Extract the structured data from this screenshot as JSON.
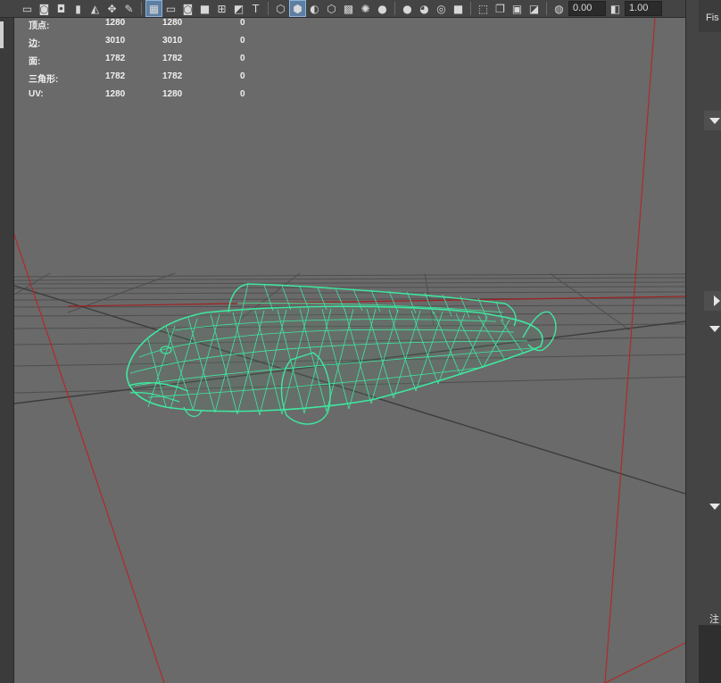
{
  "toolbar": {
    "camera_value": "0.00",
    "gamma_value": "1.00",
    "icons": [
      "camera-icon",
      "camera-attributes-icon",
      "bookmark-icon",
      "image-plane-icon",
      "2d-pan-icon",
      "grease-pencil-icon",
      "grid-icon",
      "film-gate-icon",
      "resolution-gate-icon",
      "gate-mask-icon",
      "field-chart-icon",
      "safe-action-icon",
      "safe-title-icon",
      "wireframe-icon",
      "smooth-shade-icon",
      "default-material-icon",
      "textured-icon",
      "use-all-lights-icon",
      "shadows-icon",
      "ambient-occlusion-icon",
      "motion-blur-icon",
      "anti-aliasing-icon",
      "depth-of-field-icon",
      "isolate-select-icon",
      "xray-icon",
      "xray-joints-icon",
      "backface-culling-icon",
      "exposure-icon",
      "gamma-icon"
    ]
  },
  "hud": {
    "rows": [
      {
        "label": "顶点:",
        "a": "1280",
        "b": "1280",
        "c": "0"
      },
      {
        "label": "边:",
        "a": "3010",
        "b": "3010",
        "c": "0"
      },
      {
        "label": "面:",
        "a": "1782",
        "b": "1782",
        "c": "0"
      },
      {
        "label": "三角形:",
        "a": "1782",
        "b": "1782",
        "c": "0"
      },
      {
        "label": "UV:",
        "a": "1280",
        "b": "1280",
        "c": "0"
      }
    ]
  },
  "right_panel": {
    "tab_label": "Fis",
    "bottom_label": "注"
  },
  "colors": {
    "viewport_bg": "#6a6a6a",
    "wireframe": "#3ee8a0",
    "camera_frustum": "#b02a2a",
    "grid": "#4a4a4a"
  }
}
